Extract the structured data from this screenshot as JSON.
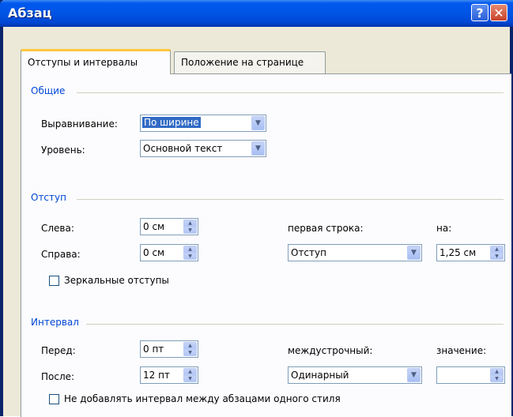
{
  "window": {
    "title": "Абзац",
    "help_label": "?",
    "close_label": "✕"
  },
  "tabs": [
    {
      "label": "Отступы и интервалы",
      "active": true
    },
    {
      "label": "Положение на странице",
      "active": false
    }
  ],
  "general": {
    "title": "Общие",
    "alignment_label": "Выравнивание:",
    "alignment_value": "По ширине",
    "level_label": "Уровень:",
    "level_value": "Основной текст"
  },
  "indent": {
    "title": "Отступ",
    "left_label": "Слева:",
    "left_value": "0 см",
    "right_label": "Справа:",
    "right_value": "0 см",
    "first_line_label": "первая строка:",
    "first_line_value": "Отступ",
    "by_label": "на:",
    "by_value": "1,25 см",
    "mirror_label": "Зеркальные отступы",
    "mirror_checked": false
  },
  "spacing": {
    "title": "Интервал",
    "before_label": "Перед:",
    "before_value": "0 пт",
    "after_label": "После:",
    "after_value": "12 пт",
    "line_label": "междустрочный:",
    "line_value": "Одинарный",
    "at_label": "значение:",
    "at_value": "",
    "dont_add_label": "Не добавлять интервал между абзацами одного стиля",
    "dont_add_checked": false
  },
  "icons": {
    "dropdown_arrow": "▼",
    "spin_up": "▲",
    "spin_down": "▼"
  },
  "colors": {
    "titlebar": "#0055E5",
    "group_title": "#0046D5",
    "dialog_bg": "#ECE9D8",
    "selection": "#316AC5"
  }
}
